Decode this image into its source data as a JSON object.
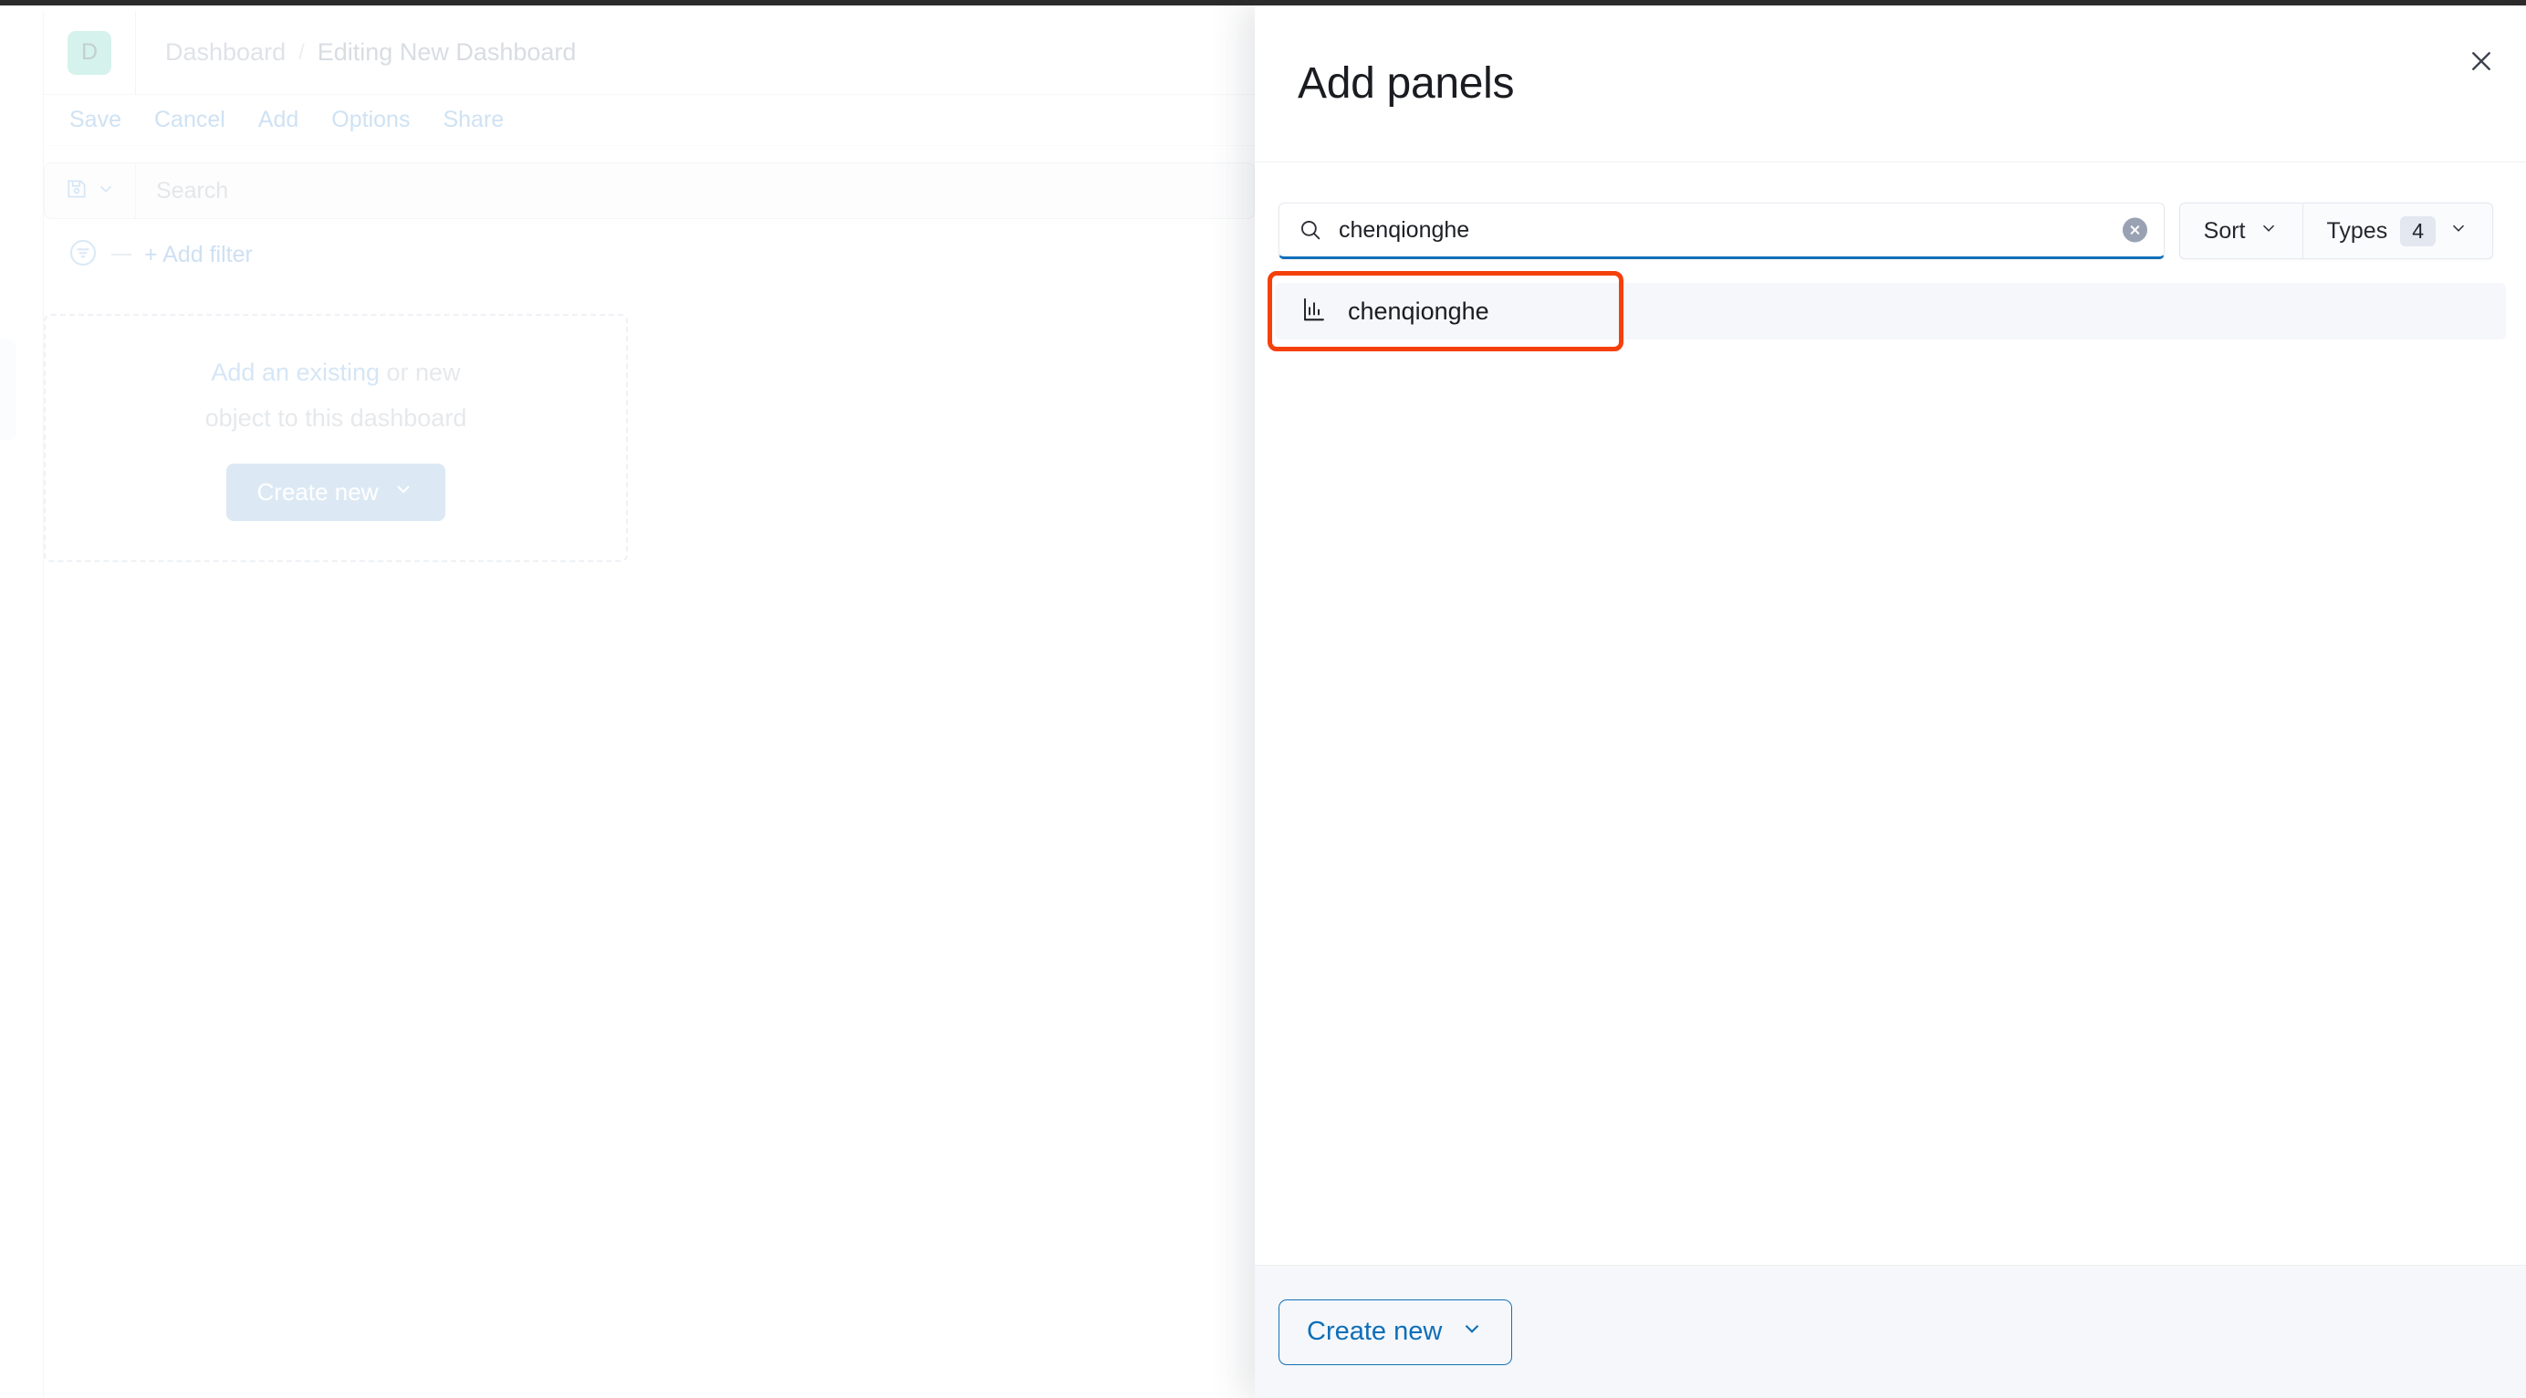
{
  "colors": {
    "accent_blue": "#0e6eb8",
    "annotation_orange": "#f5400c",
    "avatar_bg": "#d5f2ec",
    "row_hover": "#f5f7fa",
    "footer_bg": "#f5f7fa"
  },
  "background_app": {
    "avatar_letter": "D",
    "breadcrumb": {
      "root": "Dashboard",
      "separator": "/",
      "current": "Editing New Dashboard"
    },
    "toolbar": [
      {
        "label": "Save",
        "name": "save"
      },
      {
        "label": "Cancel",
        "name": "cancel"
      },
      {
        "label": "Add",
        "name": "add"
      },
      {
        "label": "Options",
        "name": "options"
      },
      {
        "label": "Share",
        "name": "share"
      }
    ],
    "query_bar": {
      "saved_query_icon": "save-disk-icon",
      "saved_query_chevron": "chevron-down-icon",
      "search_placeholder": "Search",
      "search_value": ""
    },
    "filter_bar": {
      "filter_icon": "filter-circle-icon",
      "add_filter_label": "+ Add filter"
    },
    "dropzone": {
      "line1_link": "Add an existing",
      "line1_rest": " or new",
      "line2": "object to this dashboard",
      "create_button": "Create new",
      "create_button_chevron": "chevron-down-icon"
    }
  },
  "flyout": {
    "title": "Add panels",
    "close_icon": "close-icon",
    "search": {
      "icon": "search-icon",
      "value": "chenqionghe",
      "placeholder": "Search",
      "clear_icon": "clear-circle-icon"
    },
    "sort": {
      "label": "Sort",
      "chevron": "chevron-down-icon"
    },
    "types": {
      "label": "Types",
      "count": "4",
      "chevron": "chevron-down-icon"
    },
    "results": [
      {
        "icon": "bar-chart-icon",
        "label": "chenqionghe"
      }
    ],
    "footer": {
      "create_button": "Create new",
      "chevron": "chevron-down-icon"
    }
  }
}
